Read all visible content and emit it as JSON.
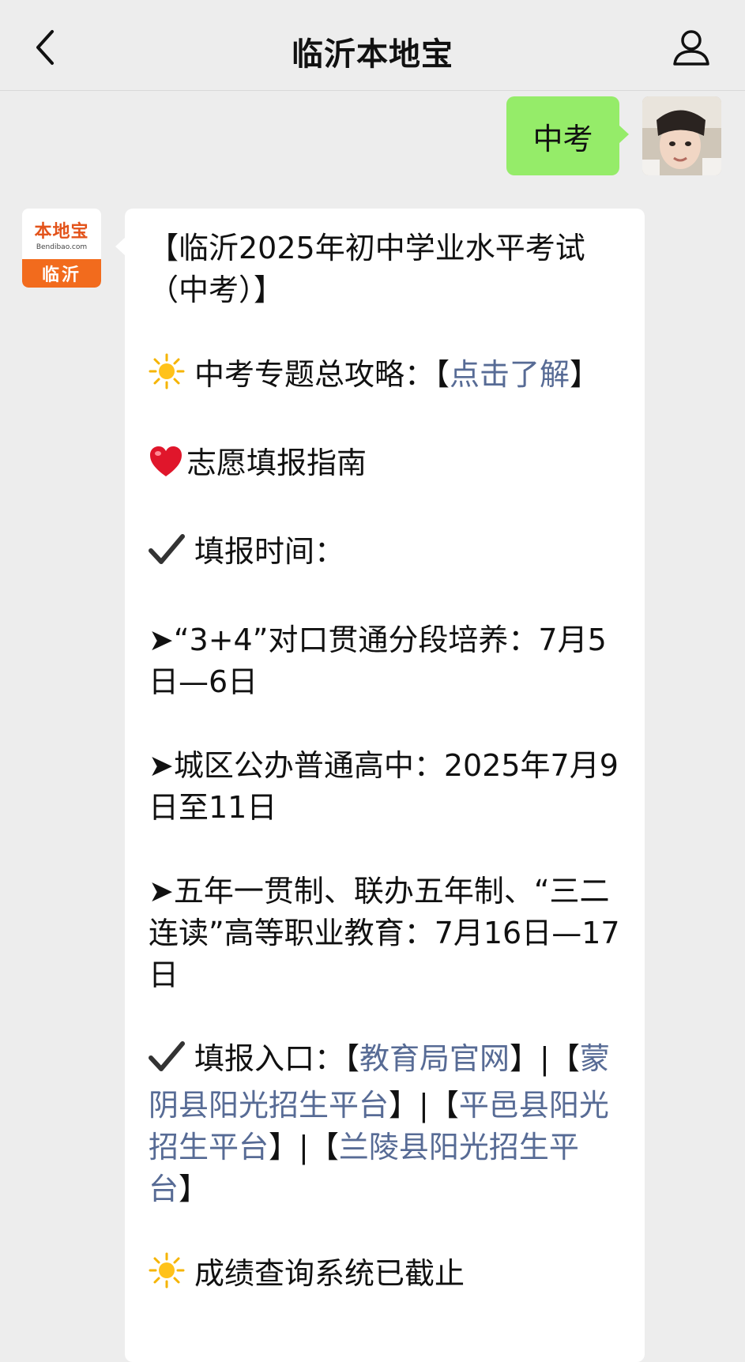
{
  "header": {
    "title": "临沂本地宝",
    "back_icon": "chevron-left-icon",
    "profile_icon": "user-icon"
  },
  "outgoing": {
    "text": "中考",
    "bubble_color": "#95ec69"
  },
  "incoming": {
    "avatar": {
      "brand": "本地宝",
      "domain": "Bendibao.com",
      "city": "临沂"
    },
    "heading": "【临沂2025年初中学业水平考试（中考）】",
    "guide": {
      "label": "中考专题总攻略：【",
      "link": "点击了解",
      "close": "】"
    },
    "volunteer_title": "志愿填报指南",
    "time_title": "填报时间：",
    "time_items": [
      "➤“3+4”对口贯通分段培养：7月5日—6日",
      "➤城区公办普通高中：2025年7月9日至11日",
      "➤五年一贯制、联办五年制、“三二连读”高等职业教育：7月16日—17日"
    ],
    "entry": {
      "label": "填报入口：",
      "links": [
        "教育局官网",
        "蒙阴县阳光招生平台",
        "平邑县阳光招生平台",
        "兰陵县阳光招生平台"
      ]
    },
    "score_notice": "成绩查询系统已截止",
    "link_color": "#576b95"
  }
}
